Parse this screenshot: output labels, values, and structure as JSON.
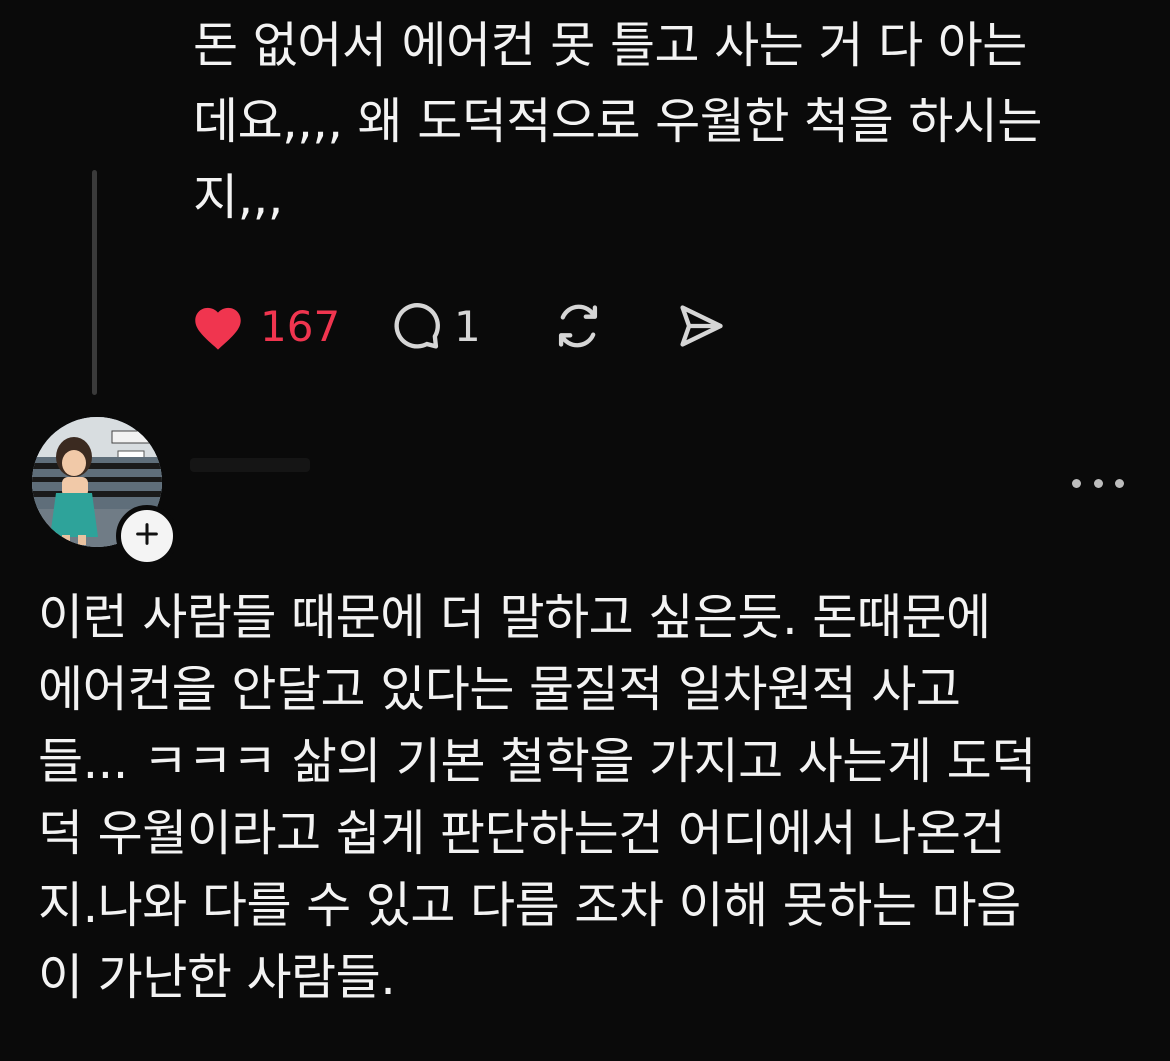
{
  "parent_post": {
    "text": "돈 없어서 에어컨 못 틀고 사는 거 다 아는\n데요,,,, 왜 도덕적으로 우월한 척을 하시는\n지,,,",
    "like_count": "167",
    "reply_count": "1",
    "liked": true
  },
  "reply_post": {
    "text": "이런 사람들 때문에 더 말하고 싶은듯. 돈때문에\n에어컨을 안달고 있다는 물질적 일차원적 사고\n들... ㅋㅋㅋ 삶의 기본 철학을 가지고 사는게 도덕\n덕 우월이라고 쉽게 판단하는건 어디에서 나온건\n지.나와 다를 수 있고 다름 조차 이해 못하는 마음\n이 가난한 사람들."
  },
  "icons": {
    "like": "heart-icon",
    "reply": "comment-bubble-icon",
    "repost": "repost-icon",
    "share": "send-icon",
    "follow": "plus-icon",
    "more": "more-dots-icon"
  },
  "colors": {
    "background": "#0a0a0a",
    "text": "#f3f3f3",
    "like": "#f0354f",
    "icon": "#d6d6d6"
  }
}
